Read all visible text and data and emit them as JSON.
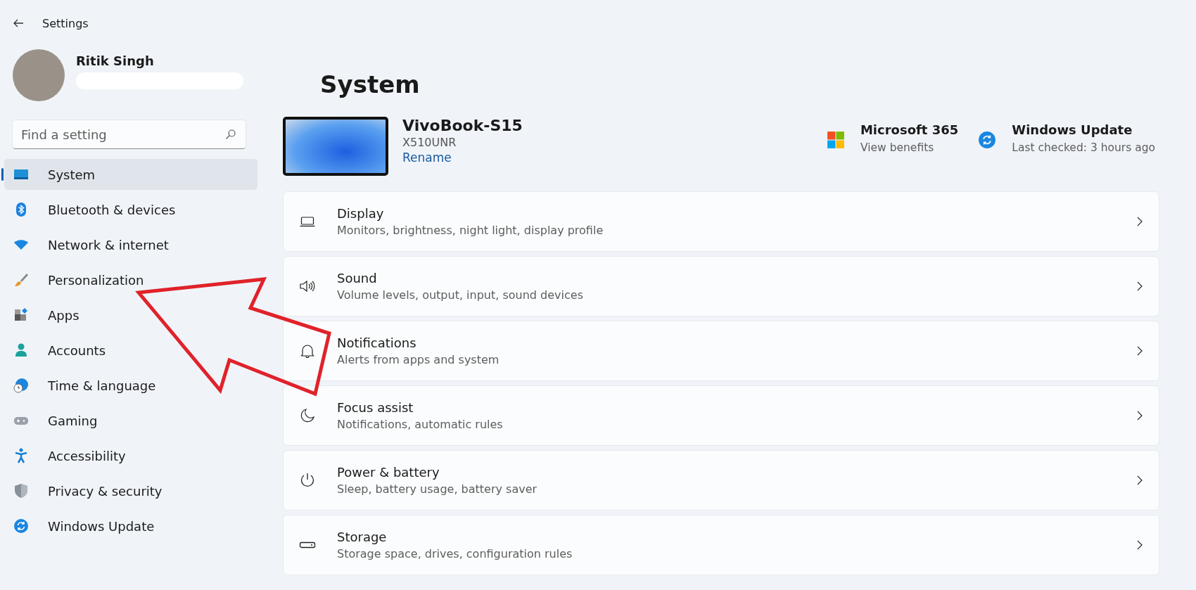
{
  "window": {
    "title": "Settings"
  },
  "account": {
    "name": "Ritik Singh"
  },
  "search": {
    "placeholder": "Find a setting"
  },
  "nav": [
    {
      "label": "System",
      "selected": true
    },
    {
      "label": "Bluetooth & devices",
      "selected": false
    },
    {
      "label": "Network & internet",
      "selected": false
    },
    {
      "label": "Personalization",
      "selected": false
    },
    {
      "label": "Apps",
      "selected": false
    },
    {
      "label": "Accounts",
      "selected": false
    },
    {
      "label": "Time & language",
      "selected": false
    },
    {
      "label": "Gaming",
      "selected": false
    },
    {
      "label": "Accessibility",
      "selected": false
    },
    {
      "label": "Privacy & security",
      "selected": false
    },
    {
      "label": "Windows Update",
      "selected": false
    }
  ],
  "page": {
    "title": "System"
  },
  "device": {
    "name": "VivoBook-S15",
    "model": "X510UNR",
    "rename": "Rename"
  },
  "quick_links": [
    {
      "title": "Microsoft 365",
      "subtitle": "View benefits"
    },
    {
      "title": "Windows Update",
      "subtitle": "Last checked: 3 hours ago"
    }
  ],
  "settings": [
    {
      "title": "Display",
      "subtitle": "Monitors, brightness, night light, display profile"
    },
    {
      "title": "Sound",
      "subtitle": "Volume levels, output, input, sound devices"
    },
    {
      "title": "Notifications",
      "subtitle": "Alerts from apps and system"
    },
    {
      "title": "Focus assist",
      "subtitle": "Notifications, automatic rules"
    },
    {
      "title": "Power & battery",
      "subtitle": "Sleep, battery usage, battery saver"
    },
    {
      "title": "Storage",
      "subtitle": "Storage space, drives, configuration rules"
    }
  ]
}
